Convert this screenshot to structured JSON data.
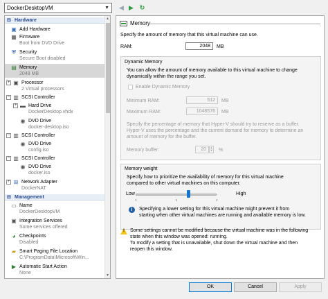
{
  "vm_selector": {
    "value": "DockerDesktopVM"
  },
  "toolbar": {
    "back_icon": "back-arrow",
    "forward_icon": "play-forward",
    "refresh_icon": "refresh"
  },
  "sidebar": {
    "hardware_header": "Hardware",
    "management_header": "Management",
    "hardware_items": [
      {
        "label": "Add Hardware",
        "sub": "",
        "icon": "add-hardware-icon"
      },
      {
        "label": "Firmware",
        "sub": "Boot from DVD Drive",
        "icon": "firmware-icon"
      },
      {
        "label": "Security",
        "sub": "Secure Boot disabled",
        "icon": "shield-icon"
      },
      {
        "label": "Memory",
        "sub": "2048 MB",
        "icon": "memory-icon"
      },
      {
        "label": "Processor",
        "sub": "2 Virtual processors",
        "icon": "processor-icon"
      },
      {
        "label": "SCSI Controller",
        "sub": "",
        "icon": "scsi-icon"
      },
      {
        "label": "Hard Drive",
        "sub": "DockerDesktop.vhdx",
        "icon": "hard-drive-icon"
      },
      {
        "label": "DVD Drive",
        "sub": "docker-desktop.iso",
        "icon": "dvd-icon"
      },
      {
        "label": "SCSI Controller",
        "sub": "",
        "icon": "scsi-icon"
      },
      {
        "label": "DVD Drive",
        "sub": "config.iso",
        "icon": "dvd-icon"
      },
      {
        "label": "SCSI Controller",
        "sub": "",
        "icon": "scsi-icon"
      },
      {
        "label": "DVD Drive",
        "sub": "docker.iso",
        "icon": "dvd-icon"
      },
      {
        "label": "Network Adapter",
        "sub": "DockerNAT",
        "icon": "network-icon"
      }
    ],
    "management_items": [
      {
        "label": "Name",
        "sub": "DockerDesktopVM",
        "icon": "name-icon"
      },
      {
        "label": "Integration Services",
        "sub": "Some services offered",
        "icon": "integration-icon"
      },
      {
        "label": "Checkpoints",
        "sub": "Disabled",
        "icon": "checkpoint-icon"
      },
      {
        "label": "Smart Paging File Location",
        "sub": "C:\\ProgramData\\Microsoft\\Win...",
        "icon": "folder-icon"
      },
      {
        "label": "Automatic Start Action",
        "sub": "None",
        "icon": "start-action-icon"
      }
    ]
  },
  "memory": {
    "title": "Memory",
    "intro": "Specify the amount of memory that this virtual machine can use.",
    "ram_label": "RAM:",
    "ram_value": "2048",
    "ram_unit": "MB",
    "dynamic": {
      "title": "Dynamic Memory",
      "desc1": "You can allow the amount of memory available to this virtual machine to change",
      "desc2": "dynamically within the range you set.",
      "enable_label": "Enable Dynamic Memory",
      "min_label": "Minimum RAM:",
      "min_value": "512",
      "min_unit": "MB",
      "max_label": "Maximum RAM:",
      "max_value": "1048576",
      "max_unit": "MB",
      "buf_desc1": "Specify the percentage of memory that Hyper-V should try to reserve as a buffer.",
      "buf_desc2": "Hyper-V uses the percentage and the current demand for memory to determine an",
      "buf_desc3": "amount of memory for the buffer.",
      "buf_label": "Memory buffer:",
      "buf_value": "20",
      "buf_unit": "%"
    },
    "weight": {
      "title": "Memory weight",
      "desc1": "Specify how to prioritize the availability of memory for this virtual machine",
      "desc2": "compared to other virtual machines on this computer.",
      "low": "Low",
      "high": "High",
      "level": 0.65,
      "info1": "Specifying a lower setting for this virtual machine might prevent it from",
      "info2": "starting when other virtual machines are running and available memory is low."
    },
    "warning": {
      "l1": "Some settings cannot be modified because the virtual machine was in the following",
      "l2": "state when this window was opened: running.",
      "l3": "To modify a setting that is unavailable, shut down the virtual machine and then",
      "l4": "reopen this window."
    }
  },
  "buttons": {
    "ok": "OK",
    "cancel": "Cancel",
    "apply": "Apply"
  },
  "colors": {
    "section_header": "#2b4b8f",
    "accent": "#0078d7",
    "slider": "#1874d2",
    "warning": "#f2c418"
  }
}
